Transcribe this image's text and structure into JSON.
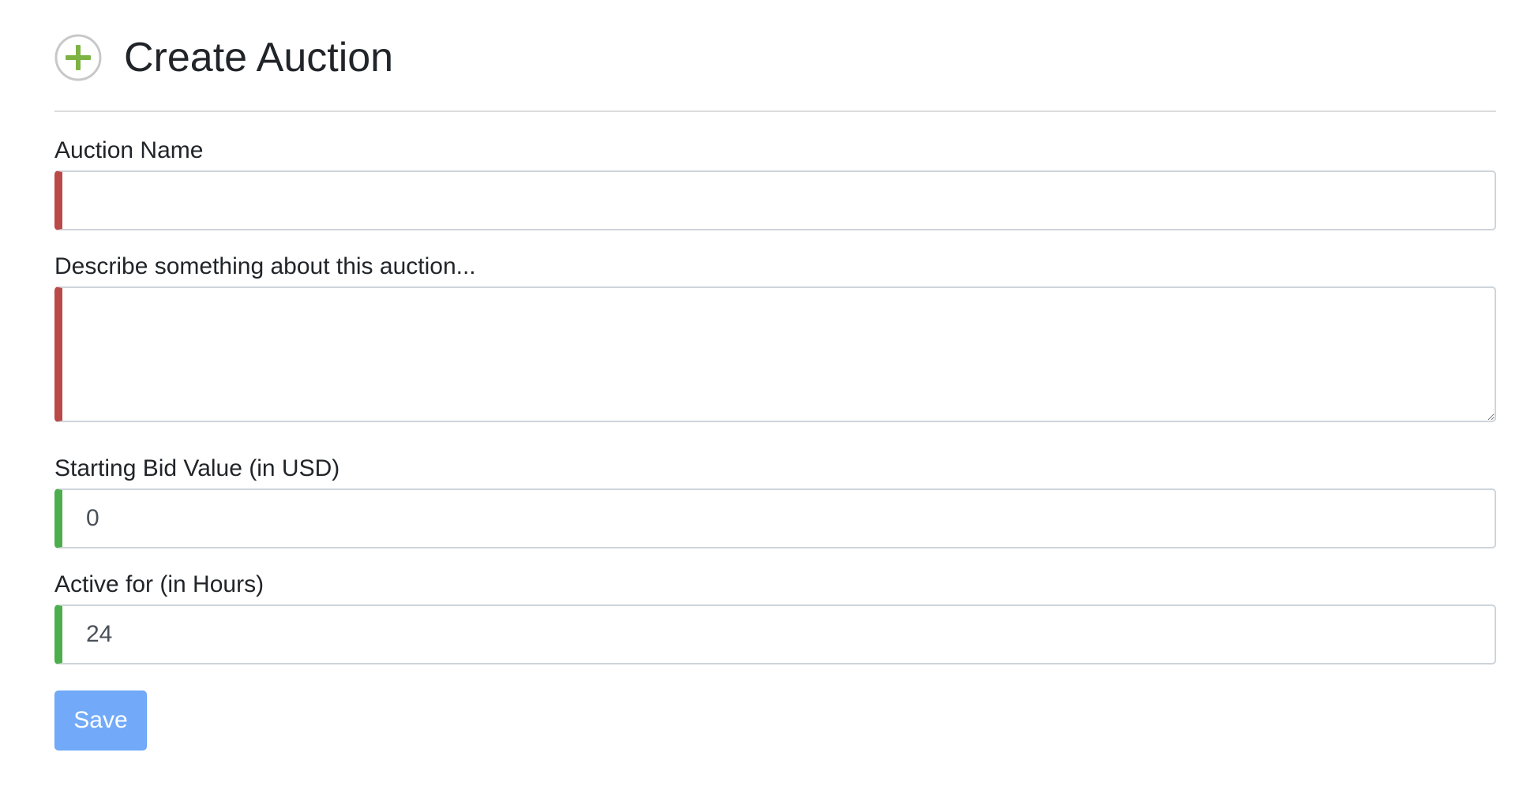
{
  "page": {
    "title": "Create Auction",
    "icon": "plus-circle-icon",
    "icon_color": "#7cb342"
  },
  "form": {
    "name": {
      "label": "Auction Name",
      "value": "",
      "status": "invalid"
    },
    "description": {
      "label": "Describe something about this auction...",
      "value": "",
      "status": "invalid"
    },
    "starting_bid": {
      "label": "Starting Bid Value (in USD)",
      "value": "0",
      "status": "valid"
    },
    "active_hours": {
      "label": "Active for (in Hours)",
      "value": "24",
      "status": "valid"
    },
    "save_label": "Save"
  },
  "colors": {
    "invalid": "#b94a48",
    "valid": "#4cae4c",
    "primary_button": "#72aaf9"
  }
}
